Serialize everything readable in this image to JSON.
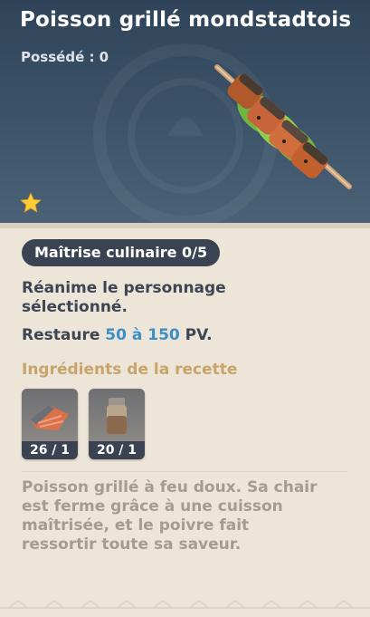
{
  "item": {
    "name": "Poisson grillé mondstadtois",
    "owned": "Possédé : 0",
    "rarity_stars": 1,
    "dish_icon": "grilled-fish-skewer-icon"
  },
  "mastery": "Maîtrise culinaire 0/5",
  "effect": {
    "line1": "Réanime le personnage",
    "line2": "sélectionné.",
    "restore_prefix": "Restaure ",
    "restore_value": "50 à 150",
    "restore_suffix": " PV."
  },
  "ingredients": {
    "title": "Ingrédients de la recette",
    "items": [
      {
        "icon": "fish-fillet-icon",
        "count": "26 / 1"
      },
      {
        "icon": "pepper-jar-icon",
        "count": "20 / 1"
      }
    ]
  },
  "flavor": {
    "line1": "Poisson grillé à feu doux. Sa chair",
    "line2": "est ferme grâce à une cuisson",
    "line3": "maîtrisée, et le poivre fait",
    "line4": "ressortir toute sa saveur."
  },
  "colors": {
    "header": "#3c5369",
    "body": "#ece5d8",
    "accent_value": "#3b8fc7",
    "ingredient_title": "#c8a46a",
    "star": "#ffcc33"
  }
}
